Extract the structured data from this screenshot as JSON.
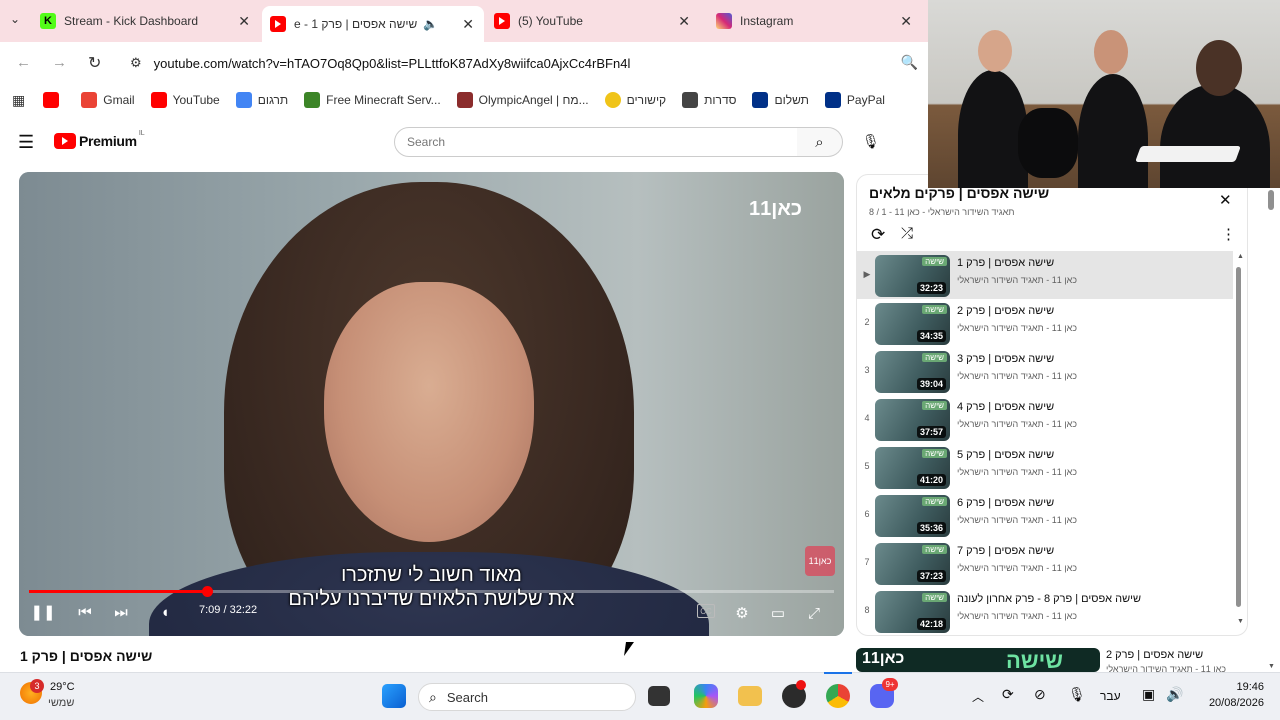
{
  "browser": {
    "tabs": [
      {
        "title": "Stream - Kick Dashboard",
        "icon": "kick-icon",
        "color": "#53fc18"
      },
      {
        "title": "שישה אפסים | פרק 1 - e",
        "icon": "youtube-icon",
        "color": "#ff0000"
      },
      {
        "title": "(5) YouTube",
        "icon": "youtube-icon",
        "color": "#ff0000"
      },
      {
        "title": "Instagram",
        "icon": "instagram-icon",
        "color": "#d62976"
      }
    ],
    "url": "youtube.com/watch?v=hTAO7Oq8Qp0&list=PLLttfoK87AdXy8wiifca0AjxCc4rBFn4l",
    "bookmarks": [
      {
        "label": "",
        "icon": "youtube-icon",
        "color": "#ff0000"
      },
      {
        "label": "Gmail",
        "icon": "gmail-icon",
        "color": "#ea4335"
      },
      {
        "label": "YouTube",
        "icon": "youtube-icon",
        "color": "#ff0000"
      },
      {
        "label": "תרגום",
        "icon": "translate-icon",
        "color": "#4285f4"
      },
      {
        "label": "Free Minecraft Serv...",
        "icon": "minecraft-icon",
        "color": "#3c8527"
      },
      {
        "label": "OlympicAngel | מח...",
        "icon": "olympic-icon",
        "color": "#8b2c2c"
      },
      {
        "label": "קישורים",
        "icon": "link-icon",
        "color": "#f0c419"
      },
      {
        "label": "סדרות",
        "icon": "tv-icon",
        "color": "#444"
      },
      {
        "label": "תשלום",
        "icon": "paypal-icon",
        "color": "#003087"
      },
      {
        "label": "PayPal",
        "icon": "paypal-icon",
        "color": "#003087"
      }
    ]
  },
  "youtube": {
    "logo": "Premium",
    "region": "IL",
    "search_placeholder": "Search",
    "player": {
      "channel_watermark": "כאן11",
      "subtitle_line1": "מאוד חשוב לי שתזכרו",
      "subtitle_line2": "את שלושת הלאוים שדיברנו עליהם",
      "time": "7:09 / 32:22",
      "progress": 0.221
    },
    "video_title": "שישה אפסים | פרק 1",
    "playlist": {
      "title": "שישה אפסים | פרקים מלאים",
      "meta": "תאגיד השידור הישראלי - כאן 11 - 1 / 8",
      "items": [
        {
          "index": "▶",
          "title": "שישה אפסים | פרק 1",
          "channel": "כאן 11 - תאגיד השידור הישראלי",
          "duration": "32:23",
          "active": true
        },
        {
          "index": "2",
          "title": "שישה אפסים | פרק 2",
          "channel": "כאן 11 - תאגיד השידור הישראלי",
          "duration": "34:35"
        },
        {
          "index": "3",
          "title": "שישה אפסים | פרק 3",
          "channel": "כאן 11 - תאגיד השידור הישראלי",
          "duration": "39:04"
        },
        {
          "index": "4",
          "title": "שישה אפסים | פרק 4",
          "channel": "כאן 11 - תאגיד השידור הישראלי",
          "duration": "37:57"
        },
        {
          "index": "5",
          "title": "שישה אפסים | פרק 5",
          "channel": "כאן 11 - תאגיד השידור הישראלי",
          "duration": "41:20"
        },
        {
          "index": "6",
          "title": "שישה אפסים | פרק 6",
          "channel": "כאן 11 - תאגיד השידור הישראלי",
          "duration": "35:36"
        },
        {
          "index": "7",
          "title": "שישה אפסים | פרק 7",
          "channel": "כאן 11 - תאגיד השידור הישראלי",
          "duration": "37:23"
        },
        {
          "index": "8",
          "title": "שישה אפסים | פרק 8 - פרק אחרון לעונה",
          "channel": "כאן 11 - תאגיד השידור הישראלי",
          "duration": "42:18"
        }
      ],
      "thumb_label": "שישה"
    },
    "recommendation": {
      "title": "שישה אפסים | פרק 2",
      "channel": "כאן 11 - תאגיד השידור הישראלי"
    }
  },
  "taskbar": {
    "weather_temp": "29°C",
    "weather_desc": "שמשי",
    "weather_badge": "3",
    "search_label": "Search",
    "language": "עבר",
    "time": "19:46",
    "date": "20/08/2026",
    "discord_badge": "9+"
  }
}
